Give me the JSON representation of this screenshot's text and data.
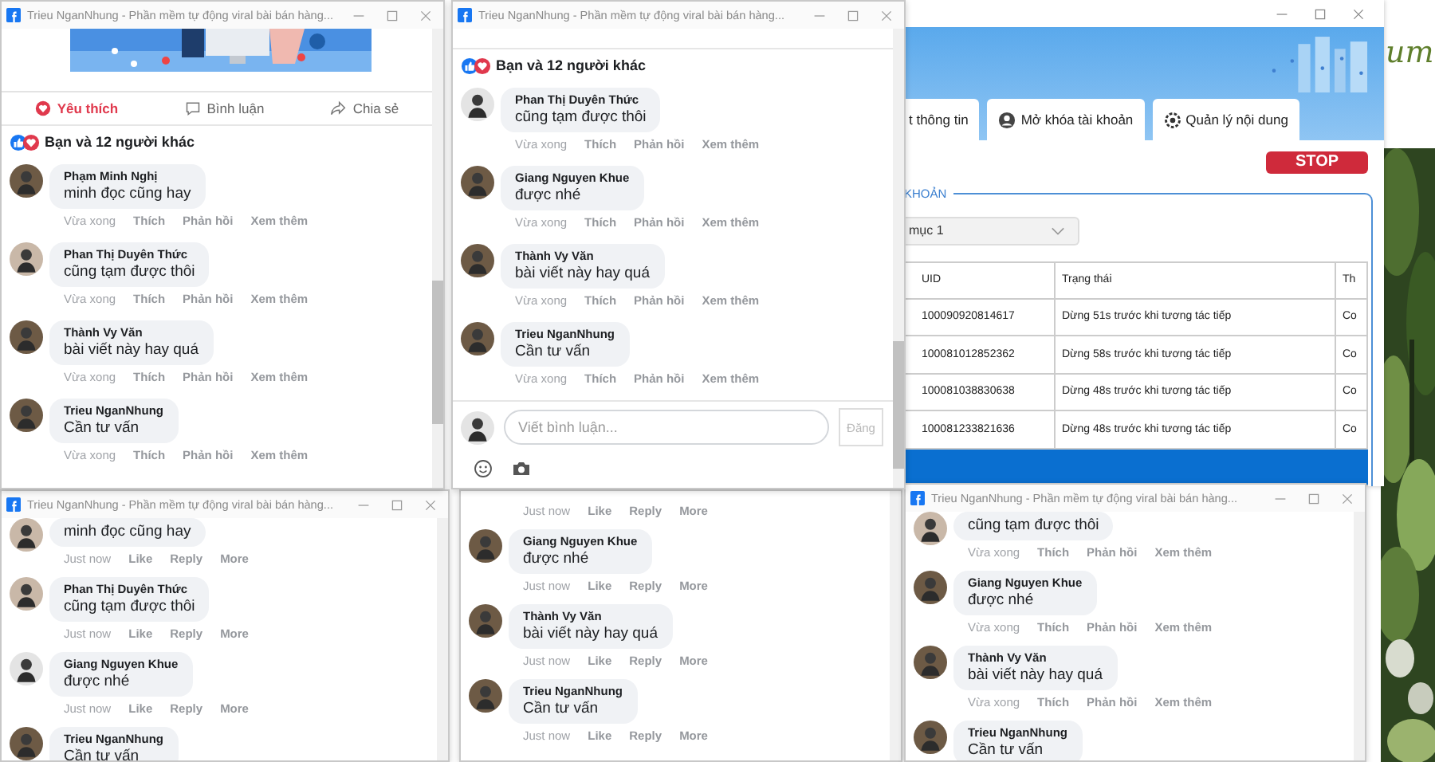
{
  "website": {
    "logo_text": "um"
  },
  "app": {
    "tabs": [
      {
        "label": "t thông tin"
      },
      {
        "label": "Mở khóa tài khoản"
      },
      {
        "label": "Quản lý nội dung"
      }
    ],
    "stop_button": "STOP",
    "group_label": "KHOẢN",
    "dropdown": {
      "value": "mục 1"
    },
    "table": {
      "columns": [
        "UID",
        "Trạng thái",
        "Th"
      ],
      "rows": [
        {
          "cells": [
            "100090920814617",
            "Dừng 51s trước khi tương tác tiếp",
            "Co"
          ],
          "selected": false
        },
        {
          "cells": [
            "100081012852362",
            "Dừng 58s trước khi tương tác tiếp",
            "Co"
          ],
          "selected": false
        },
        {
          "cells": [
            "100081038830638",
            "Dừng 48s trước khi tương tác tiếp",
            "Co"
          ],
          "selected": false
        },
        {
          "cells": [
            "100081233821636",
            "Dừng 48s trước khi tương tác tiếp",
            "Co"
          ],
          "selected": false
        },
        {
          "selected": true
        }
      ]
    }
  },
  "windows": [
    {
      "title": "Trieu NganNhung - Phần mềm tự động viral bài bán hàng...",
      "banner": {
        "kind": "picture"
      },
      "post_actions": [
        {
          "label": "Yêu thích",
          "kind": "heart",
          "selected": true
        },
        {
          "label": "Bình luận",
          "kind": "comment",
          "selected": false
        },
        {
          "label": "Chia sẻ",
          "kind": "share",
          "selected": false
        }
      ],
      "reactions": "Bạn và 12 người khác",
      "comments": [
        {
          "name": "Phạm Minh Nghị",
          "text": "minh đọc cũng hay",
          "actions": [
            "Vừa xong",
            "Thích",
            "Phản hồi",
            "Xem thêm"
          ]
        },
        {
          "name": "Phan Thị Duyên Thức",
          "text": "cũng tạm được thôi",
          "actions": [
            "Vừa xong",
            "Thích",
            "Phản hồi",
            "Xem thêm"
          ]
        },
        {
          "name": "Thành Vy Văn",
          "text": "bài viết này hay quá",
          "actions": [
            "Vừa xong",
            "Thích",
            "Phản hồi",
            "Xem thêm"
          ]
        },
        {
          "name": "Trieu NganNhung",
          "text": "Cần tư vấn",
          "actions": [
            "Vừa xong",
            "Thích",
            "Phản hồi",
            "Xem thêm"
          ]
        }
      ]
    },
    {
      "title": "Trieu NganNhung - Phần mềm tự động viral bài bán hàng...",
      "reactions": "Bạn và 12 người khác",
      "comments": [
        {
          "name": "Phan Thị Duyên Thức",
          "text": "cũng tạm được thôi",
          "actions": [
            "Vừa xong",
            "Thích",
            "Phản hồi",
            "Xem thêm"
          ]
        },
        {
          "name": "Giang Nguyen Khue",
          "text": "được nhé",
          "actions": [
            "Vừa xong",
            "Thích",
            "Phản hồi",
            "Xem thêm"
          ]
        },
        {
          "name": "Thành Vy Văn",
          "text": "bài viết này hay quá",
          "actions": [
            "Vừa xong",
            "Thích",
            "Phản hồi",
            "Xem thêm"
          ]
        },
        {
          "name": "Trieu NganNhung",
          "text": "Cần tư vấn",
          "actions": [
            "Vừa xong",
            "Thích",
            "Phản hồi",
            "Xem thêm"
          ]
        }
      ],
      "composer": {
        "placeholder": "Viết bình luận...",
        "button": "Đăng"
      }
    },
    {
      "title": "Trieu NganNhung - Phần mềm tự động viral bài bán hàng...",
      "comments": [
        {
          "text": "minh đọc cũng hay",
          "actions": [
            "Just now",
            "Like",
            "Reply",
            "More"
          ]
        },
        {
          "name": "Phan Thị Duyên Thức",
          "text": "cũng tạm được thôi",
          "actions": [
            "Just now",
            "Like",
            "Reply",
            "More"
          ]
        },
        {
          "name": "Giang Nguyen Khue",
          "text": "được nhé",
          "actions": [
            "Just now",
            "Like",
            "Reply",
            "More"
          ]
        },
        {
          "name": "Trieu NganNhung",
          "text": "Cần tư vấn"
        }
      ]
    },
    {
      "comments": [
        {
          "actions": [
            "Just now",
            "Like",
            "Reply",
            "More"
          ]
        },
        {
          "name": "Giang Nguyen Khue",
          "text": "được nhé",
          "actions": [
            "Just now",
            "Like",
            "Reply",
            "More"
          ]
        },
        {
          "name": "Thành Vy Văn",
          "text": "bài viết này hay quá",
          "actions": [
            "Just now",
            "Like",
            "Reply",
            "More"
          ]
        },
        {
          "name": "Trieu NganNhung",
          "text": "Cần tư vấn",
          "actions": [
            "Just now",
            "Like",
            "Reply",
            "More"
          ]
        }
      ]
    },
    {
      "title": "Trieu NganNhung - Phần mềm tự động viral bài bán hàng...",
      "comments": [
        {
          "text": "cũng tạm được thôi",
          "actions": [
            "Vừa xong",
            "Thích",
            "Phản hồi",
            "Xem thêm"
          ]
        },
        {
          "name": "Giang Nguyen Khue",
          "text": "được nhé",
          "actions": [
            "Vừa xong",
            "Thích",
            "Phản hồi",
            "Xem thêm"
          ]
        },
        {
          "name": "Thành Vy Văn",
          "text": "bài viết này hay quá",
          "actions": [
            "Vừa xong",
            "Thích",
            "Phản hồi",
            "Xem thêm"
          ]
        },
        {
          "name": "Trieu NganNhung",
          "text": "Cần tư vấn"
        }
      ]
    }
  ]
}
